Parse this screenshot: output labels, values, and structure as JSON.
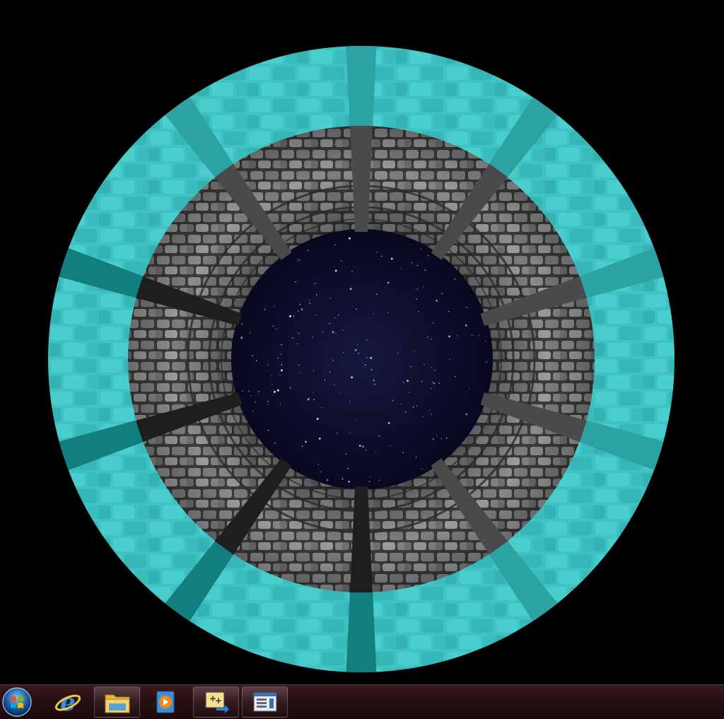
{
  "taskbar": {
    "items": [
      {
        "id": "start",
        "icon": "windows-start-orb-icon",
        "pinned_running": false
      },
      {
        "id": "ie",
        "icon": "internet-explorer-icon",
        "pinned_running": false
      },
      {
        "id": "explorer",
        "icon": "folder-icon",
        "pinned_running": true
      },
      {
        "id": "media",
        "icon": "media-player-icon",
        "pinned_running": false
      },
      {
        "id": "app1",
        "icon": "image-editor-icon",
        "pinned_running": true
      },
      {
        "id": "app2",
        "icon": "window-app-icon",
        "pinned_running": true
      }
    ]
  },
  "scene": {
    "description_colors": {
      "outer_ring": "#3bbcbc",
      "pillar_teal": "#178a8a",
      "stone": "#6e6e70",
      "sky": "#0a0a24"
    }
  }
}
